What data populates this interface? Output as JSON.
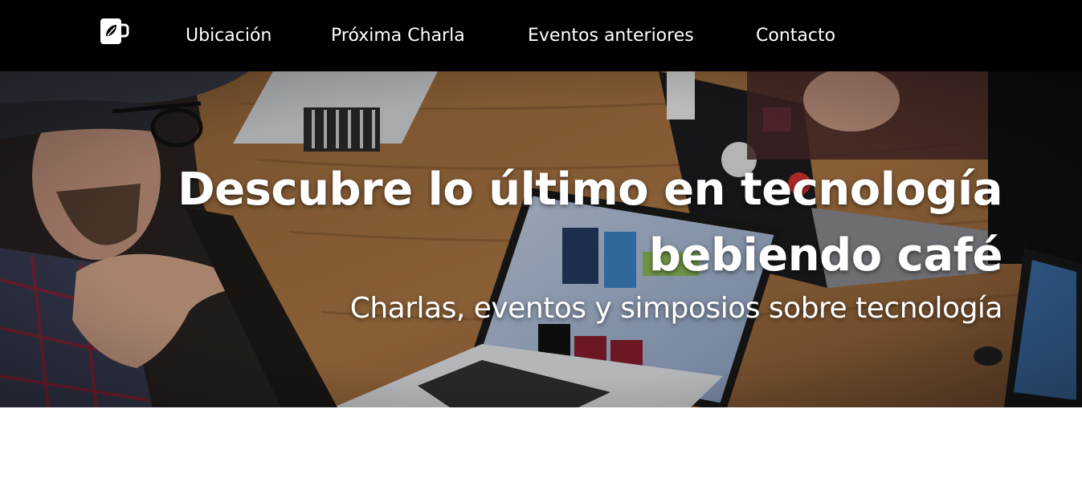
{
  "navbar": {
    "logo_icon": "coffee-cup-leaf-icon",
    "links": [
      {
        "label": "Ubicación"
      },
      {
        "label": "Próxima Charla"
      },
      {
        "label": "Eventos anteriores"
      },
      {
        "label": "Contacto"
      }
    ]
  },
  "hero": {
    "title": "Descubre lo último en tecnología bebiendo café",
    "subtitle": "Charlas, eventos y simposios sobre tecnología"
  },
  "colors": {
    "navbar_bg": "#000000",
    "text": "#ffffff",
    "page_bg": "#ffffff"
  }
}
